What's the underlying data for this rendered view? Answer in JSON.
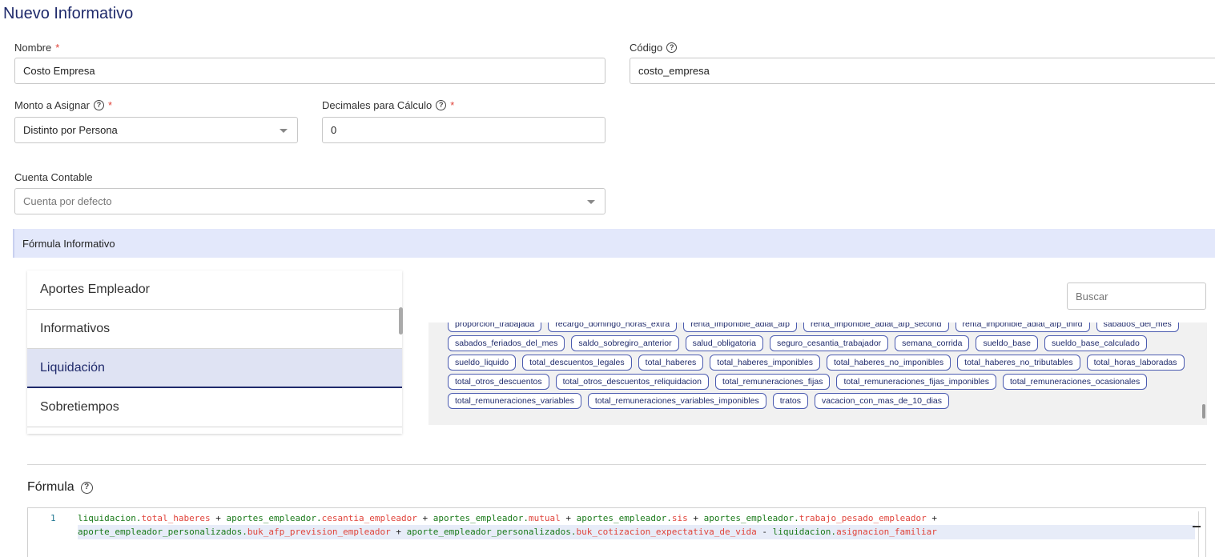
{
  "page": {
    "title": "Nuevo Informativo"
  },
  "form": {
    "nombre": {
      "label": "Nombre",
      "required": "*",
      "value": "Costo Empresa"
    },
    "codigo": {
      "label": "Código",
      "value": "costo_empresa"
    },
    "monto": {
      "label": "Monto a Asignar",
      "required": "*",
      "value": "Distinto por Persona"
    },
    "decimales": {
      "label": "Decimales para Cálculo",
      "required": "*",
      "value": "0"
    },
    "cuenta": {
      "label": "Cuenta Contable",
      "placeholder": "Cuenta por defecto"
    }
  },
  "formula_panel": {
    "header": "Fórmula Informativo",
    "categories": [
      "Aportes Empleador",
      "Informativos",
      "Liquidación",
      "Sobretiempos"
    ],
    "active_category": "Liquidación",
    "search_placeholder": "Buscar",
    "tags": [
      "proporcion_trabajada",
      "recargo_domingo_horas_extra",
      "renta_imponible_adlat_afp",
      "renta_imponible_adlat_afp_second",
      "renta_imponible_adlat_afp_third",
      "sabados_del_mes",
      "sabados_feriados_del_mes",
      "saldo_sobregiro_anterior",
      "salud_obligatoria",
      "seguro_cesantia_trabajador",
      "semana_corrida",
      "sueldo_base",
      "sueldo_base_calculado",
      "sueldo_liquido",
      "total_descuentos_legales",
      "total_haberes",
      "total_haberes_imponibles",
      "total_haberes_no_imponibles",
      "total_haberes_no_tributables",
      "total_horas_laboradas",
      "total_otros_descuentos",
      "total_otros_descuentos_reliquidacion",
      "total_remuneraciones_fijas",
      "total_remuneraciones_fijas_imponibles",
      "total_remuneraciones_ocasionales",
      "total_remuneraciones_variables",
      "total_remuneraciones_variables_imponibles",
      "tratos",
      "vacacion_con_mas_de_10_dias"
    ]
  },
  "formula": {
    "title": "Fórmula",
    "line_number": "1",
    "line1": [
      [
        "obj",
        "liquidacion."
      ],
      [
        "prop",
        "total_haberes"
      ],
      [
        "op",
        " + "
      ],
      [
        "obj",
        "aportes_empleador."
      ],
      [
        "prop",
        "cesantia_empleador"
      ],
      [
        "op",
        " + "
      ],
      [
        "obj",
        "aportes_empleador."
      ],
      [
        "prop",
        "mutual"
      ],
      [
        "op",
        " + "
      ],
      [
        "obj",
        "aportes_empleador."
      ],
      [
        "prop",
        "sis"
      ],
      [
        "op",
        " + "
      ],
      [
        "obj",
        "aportes_empleador."
      ],
      [
        "prop",
        "trabajo_pesado_empleador"
      ],
      [
        "op",
        " +"
      ]
    ],
    "line2": [
      [
        "obj",
        "aporte_empleador_personalizados."
      ],
      [
        "prop",
        "buk_afp_prevision_empleador"
      ],
      [
        "op",
        " + "
      ],
      [
        "obj",
        "aporte_empleador_personalizados."
      ],
      [
        "prop",
        "buk_cotizacion_expectativa_de_vida"
      ],
      [
        "op",
        " - "
      ],
      [
        "obj",
        "liquidacion."
      ],
      [
        "prop",
        "asignacion_familiar"
      ]
    ]
  },
  "colors": {
    "title": "#1f2a6b",
    "required": "#e0443b",
    "panel_header": "#e3e8fb",
    "code_object": "#1a7a1a",
    "code_property": "#e0443b"
  }
}
